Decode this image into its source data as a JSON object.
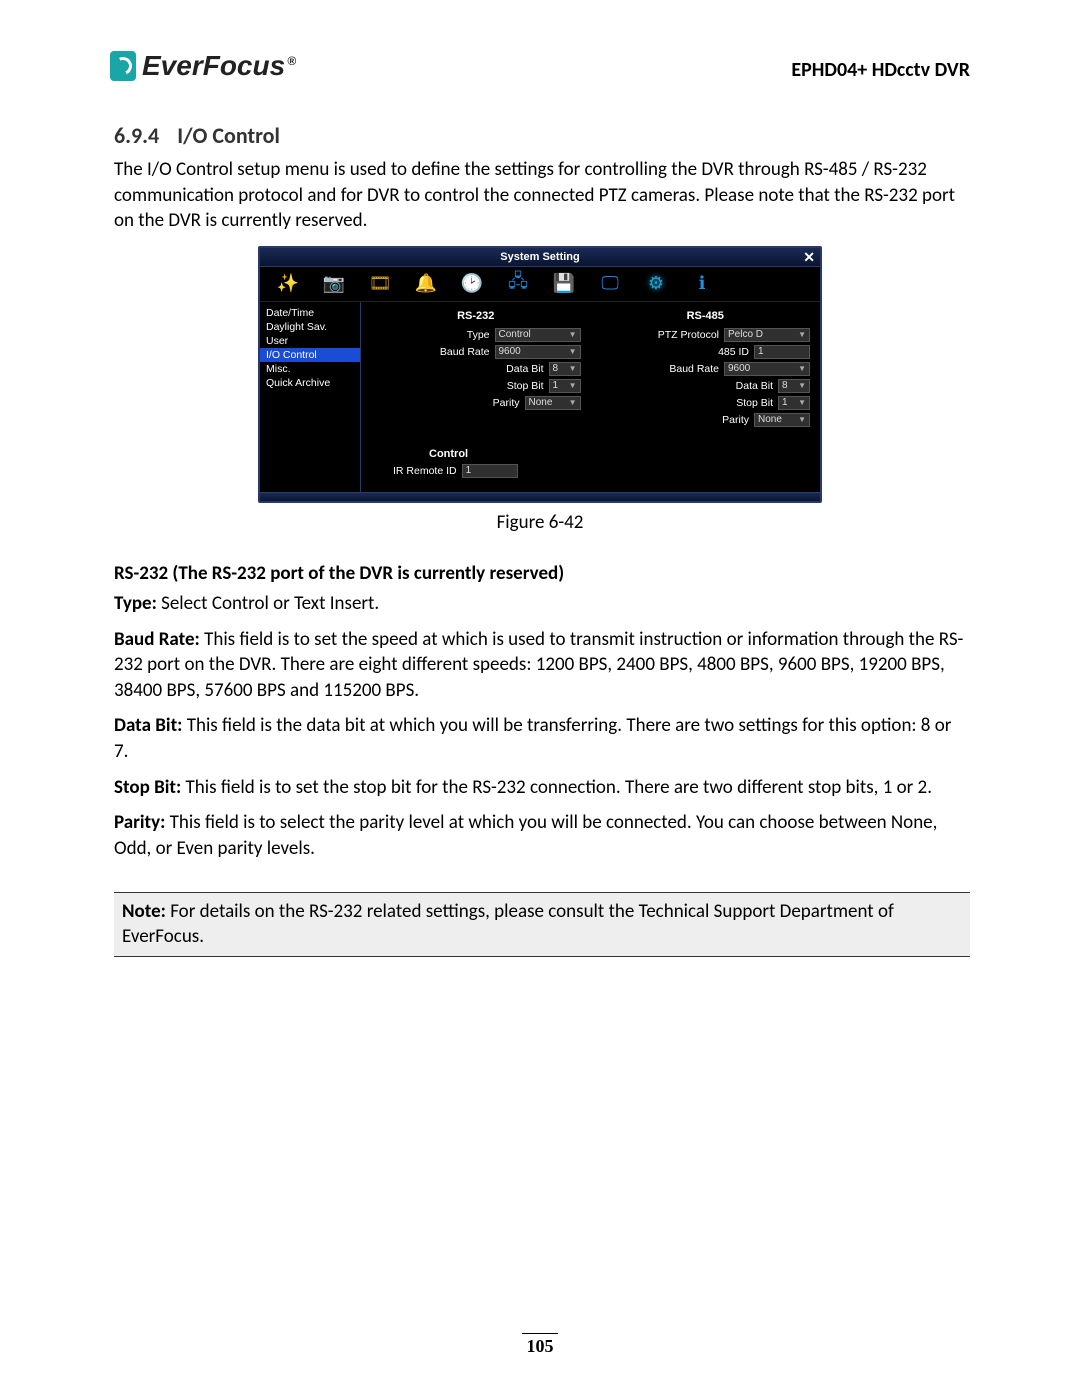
{
  "header": {
    "brand_prefix": "Ever",
    "brand_suffix": "Focus",
    "doc_title": "EPHD04+  HDcctv DVR"
  },
  "section": {
    "number": "6.9.4",
    "title": "I/O Control",
    "intro": "The I/O Control setup menu is used to define the settings for controlling the DVR through RS-485 / RS-232 communication protocol and for DVR to control the connected PTZ cameras. Please note that the RS-232 port on the DVR is currently reserved."
  },
  "dvr": {
    "window_title": "System Setting",
    "close_glyph": "✕",
    "sidebar": {
      "items": [
        {
          "label": "Date/Time"
        },
        {
          "label": "Daylight Sav."
        },
        {
          "label": "User"
        },
        {
          "label": "I/O Control"
        },
        {
          "label": "Misc."
        },
        {
          "label": "Quick Archive"
        }
      ],
      "active_index": 3
    },
    "rs232": {
      "header": "RS-232",
      "type_label": "Type",
      "type_value": "Control",
      "baud_label": "Baud Rate",
      "baud_value": "9600",
      "databit_label": "Data Bit",
      "databit_value": "8",
      "stopbit_label": "Stop Bit",
      "stopbit_value": "1",
      "parity_label": "Parity",
      "parity_value": "None"
    },
    "rs485": {
      "header": "RS-485",
      "proto_label": "PTZ Protocol",
      "proto_value": "Pelco D",
      "id_label": "485 ID",
      "id_value": "1",
      "baud_label": "Baud Rate",
      "baud_value": "9600",
      "databit_label": "Data Bit",
      "databit_value": "8",
      "stopbit_label": "Stop Bit",
      "stopbit_value": "1",
      "parity_label": "Parity",
      "parity_value": "None"
    },
    "control": {
      "header": "Control",
      "ir_label": "IR Remote ID",
      "ir_value": "1"
    }
  },
  "figure_caption": "Figure 6-42",
  "rs232_heading": "RS-232 (The RS-232 port of the DVR is currently reserved)",
  "fields": {
    "type_label": "Type:",
    "type_text": " Select Control or Text Insert.",
    "baud_label": "Baud Rate:",
    "baud_text": " This field is to set the speed at which is used to transmit instruction or information through the RS-232 port on the DVR. There are eight different speeds: 1200 BPS, 2400 BPS, 4800 BPS, 9600 BPS, 19200 BPS, 38400 BPS, 57600 BPS and 115200 BPS.",
    "databit_label": "Data Bit:",
    "databit_text": " This field is the data bit at which you will be transferring. There are two settings for this option: 8 or 7.",
    "stopbit_label": "Stop Bit:",
    "stopbit_text": " This field is to set the stop bit for the RS-232 connection. There are two different stop bits, 1 or 2.",
    "parity_label": "Parity:",
    "parity_text": " This field is to select the parity level at which you will be connected. You can choose between None, Odd, or Even parity levels."
  },
  "note": {
    "label": "Note:",
    "text": " For details on the RS-232 related settings, please consult the Technical Support Department of EverFocus."
  },
  "page_number": "105"
}
